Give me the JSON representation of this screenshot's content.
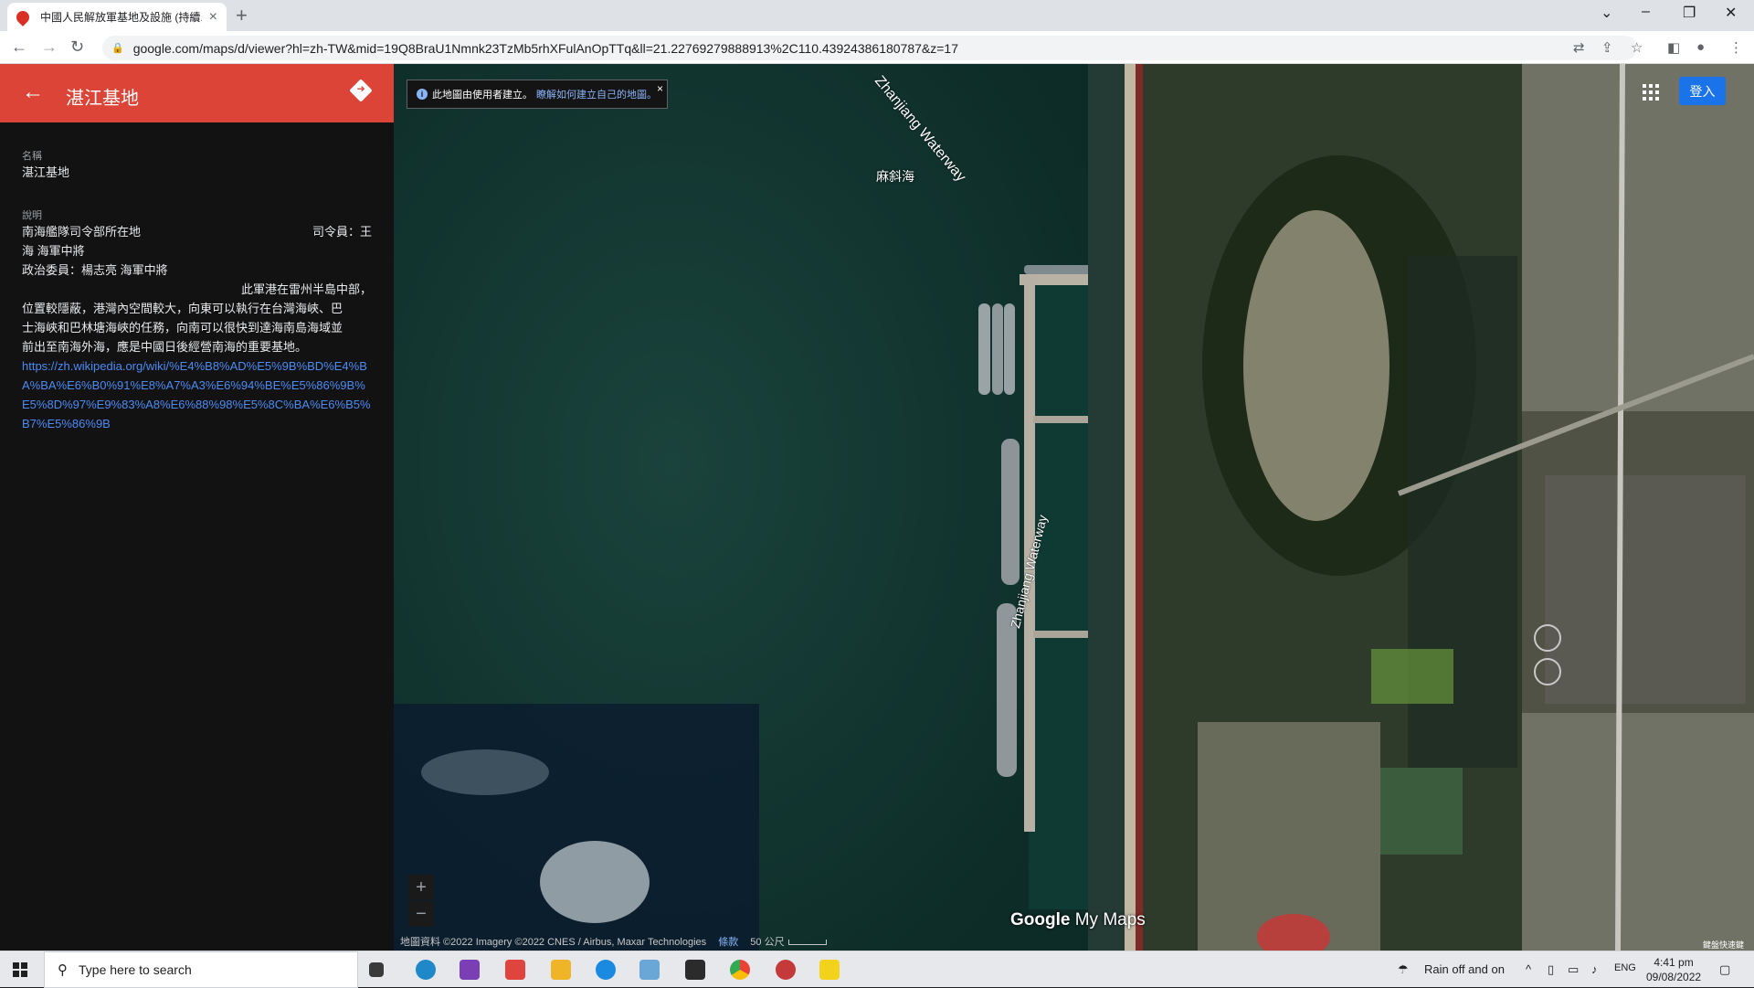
{
  "browser": {
    "tab_title": "中國人民解放軍基地及設施 (持續...",
    "url": "google.com/maps/d/viewer?hl=zh-TW&mid=19Q8BraU1Nmnk23TzMb5rhXFulAnOpTTq&ll=21.22769279888913%2C110.43924386180787&z=17"
  },
  "panel": {
    "title": "湛江基地",
    "name_label": "名稱",
    "name_value": "湛江基地",
    "desc_label": "說明",
    "desc_line1_left": "南海艦隊司令部所在地",
    "desc_line1_right": "司令員：王",
    "desc_line2": "海 海軍中將",
    "desc_line3": "政治委員：楊志亮 海軍中將",
    "desc_line4": "此軍港在雷州半島中部，",
    "desc_line5": "位置較隱蔽，港灣內空間較大，向東可以執行在台灣海峽、巴",
    "desc_line6": "士海峽和巴林塘海峽的任務，向南可以很快到達海南島海域並",
    "desc_line7": "前出至南海外海，應是中國日後經營南海的重要基地。",
    "link": "https://zh.wikipedia.org/wiki/%E4%B8%AD%E5%9B%BD%E4%BA%BA%E6%B0%91%E8%A7%A3%E6%94%BE%E5%86%9B%E5%8D%97%E9%83%A8%E6%88%98%E5%8C%BA%E6%B5%B7%E5%86%9B"
  },
  "map": {
    "notice_text": "此地圖由使用者建立。",
    "notice_link": "瞭解如何建立自己的地圖。",
    "notice_close": "×",
    "waterway_label_1": "Zhanjiang Waterway",
    "waterway_label_2": "Zhanjiang Waterway",
    "place_label": "麻斜海",
    "signin": "登入",
    "zoom_in": "+",
    "zoom_out": "−",
    "logo_google": "Google",
    "logo_mymaps": "My Maps",
    "attribution": "地圖資料 ©2022 Imagery ©2022 CNES / Airbus, Maxar Technologies",
    "terms": "條款",
    "scale": "50 公尺",
    "badge": "鍵盤快速鍵"
  },
  "taskbar": {
    "search_placeholder": "Type here to search",
    "weather": "Rain off and on",
    "lang": "ENG",
    "time": "4:41 pm",
    "date": "09/08/2022"
  },
  "colors": {
    "panel_header": "#db4437",
    "link": "#4c8bf5",
    "signin": "#1a73e8"
  }
}
